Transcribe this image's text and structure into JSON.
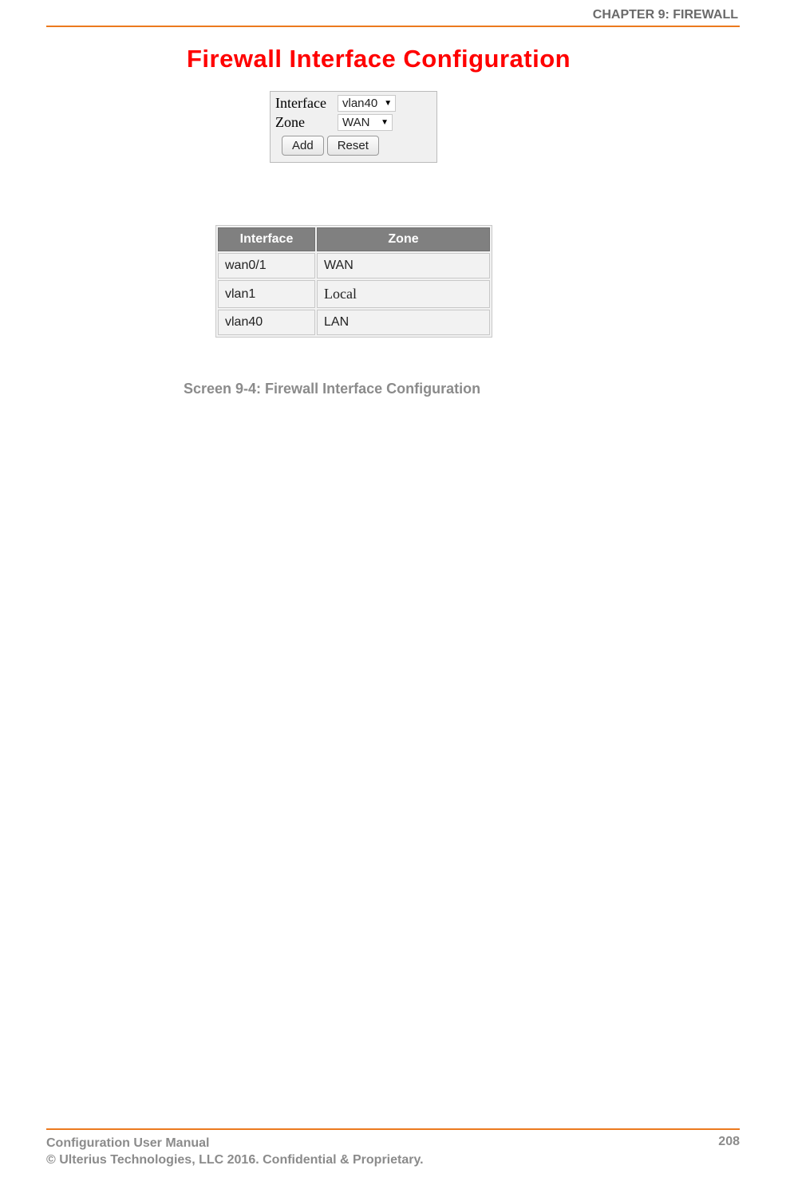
{
  "header": {
    "chapter": "CHAPTER 9: FIREWALL"
  },
  "main": {
    "title": "Firewall Interface Configuration",
    "form": {
      "interface_label": "Interface",
      "interface_value": "vlan40",
      "zone_label": "Zone",
      "zone_value": "WAN",
      "add_button": "Add",
      "reset_button": "Reset"
    },
    "table": {
      "headers": {
        "interface": "Interface",
        "zone": "Zone"
      },
      "rows": [
        {
          "interface": "wan0/1",
          "zone": "WAN"
        },
        {
          "interface": "vlan1",
          "zone": "Local"
        },
        {
          "interface": "vlan40",
          "zone": "LAN"
        }
      ]
    },
    "caption": "Screen 9-4: Firewall Interface Configuration"
  },
  "footer": {
    "line1": "Configuration User Manual",
    "line2": "© Ulterius Technologies, LLC 2016. Confidential & Proprietary.",
    "page": "208"
  }
}
